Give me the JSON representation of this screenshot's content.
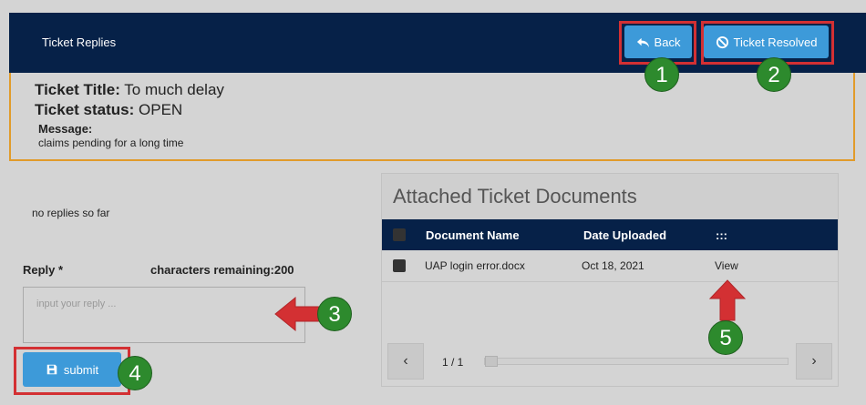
{
  "header": {
    "title": "Ticket Replies",
    "back_label": "Back",
    "resolve_label": "Ticket Resolved",
    "bg_color": "#062148",
    "button_color": "#3d9ad9"
  },
  "ticket": {
    "title_label": "Ticket Title:",
    "title_value": "To much delay",
    "status_label": "Ticket status:",
    "status_value": "OPEN",
    "message_label": "Message:",
    "message_value": "claims pending for a long time",
    "border_color": "#e19b2a"
  },
  "replies": {
    "empty_text": "no replies so far",
    "reply_label": "Reply *",
    "chars_label": "characters remaining:200",
    "input_placeholder": "input your reply ...",
    "input_value": "",
    "submit_label": "submit"
  },
  "documents": {
    "title": "Attached Ticket Documents",
    "columns": [
      "Document Name",
      "Date Uploaded",
      ":::"
    ],
    "rows": [
      {
        "name": "UAP login error.docx",
        "date": "Oct 18, 2021",
        "action": "View"
      }
    ],
    "pager": {
      "text": "1 / 1",
      "prev_icon": "chevron-left-icon",
      "next_icon": "chevron-right-icon"
    }
  },
  "annotations": {
    "badges": [
      "1",
      "2",
      "3",
      "4",
      "5"
    ],
    "badge_color": "#2d8a2d",
    "highlight_color": "#d33033"
  }
}
